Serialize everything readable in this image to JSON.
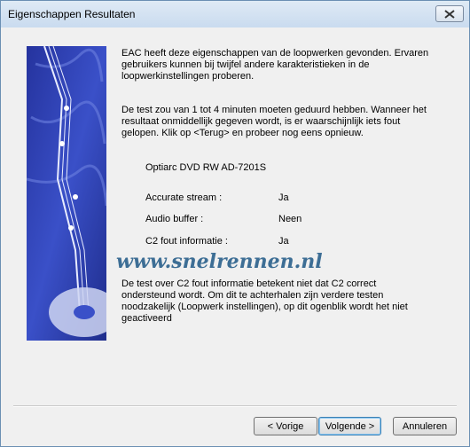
{
  "window": {
    "title": "Eigenschappen Resultaten"
  },
  "intro": "EAC heeft deze eigenschappen van de loopwerken gevonden. Ervaren gebruikers kunnen bij twijfel andere karakteristieken in de loopwerkinstellingen proberen.",
  "note": "De test zou van 1 tot 4 minuten moeten geduurd hebben. Wanneer het resultaat onmiddellijk gegeven wordt, is er waarschijnlijk iets fout gelopen. Klik op <Terug> en probeer nog eens opnieuw.",
  "drive": "Optiarc DVD RW AD-7201S",
  "features": [
    {
      "label": "Accurate stream :",
      "value": "Ja"
    },
    {
      "label": "Audio buffer :",
      "value": "Neen"
    },
    {
      "label": "C2 fout informatie :",
      "value": "Ja"
    }
  ],
  "watermark": "www.snelrennen.nl",
  "c2_note": "De test over C2 fout informatie betekent niet dat C2 correct ondersteund wordt. Om dit te achterhalen zijn verdere testen noodzakelijk (Loopwerk instellingen), op dit ogenblik wordt het niet geactiveerd",
  "buttons": {
    "back": "< Vorige",
    "next": "Volgende >",
    "cancel": "Annuleren"
  },
  "icons": {
    "close": "close-icon"
  }
}
